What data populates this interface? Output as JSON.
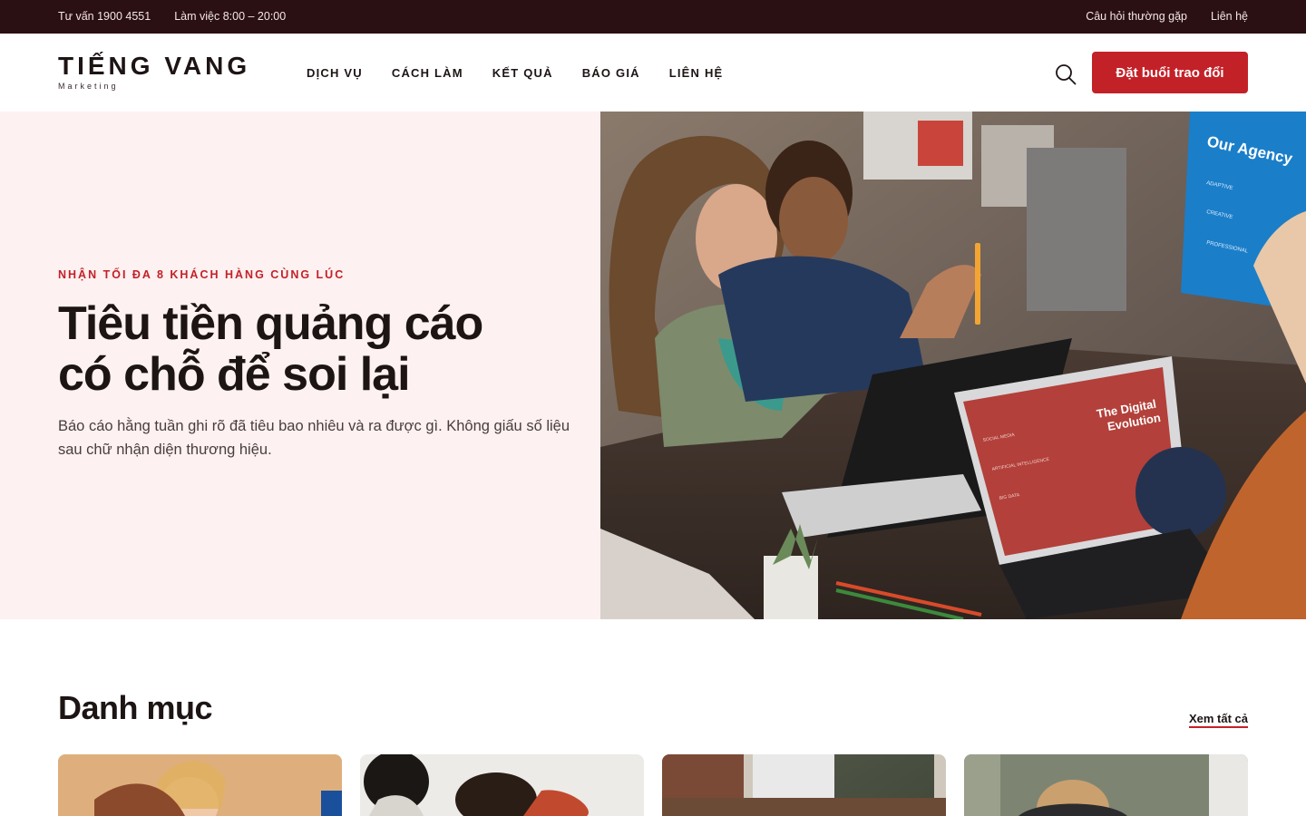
{
  "topbar": {
    "phone": "Tư vấn 1900 4551",
    "hours": "Làm việc 8:00 – 20:00",
    "faq": "Câu hỏi thường gặp",
    "contact": "Liên hệ"
  },
  "header": {
    "logo_title": "TIẾNG VANG",
    "logo_sub": "Marketing",
    "nav": [
      "DỊCH VỤ",
      "CÁCH LÀM",
      "KẾT QUẢ",
      "BÁO GIÁ",
      "LIÊN HỆ"
    ],
    "search_icon": "search-icon",
    "cta_label": "Đặt buổi trao đổi"
  },
  "hero": {
    "eyebrow": "NHẬN TỐI ĐA 8 KHÁCH HÀNG CÙNG LÚC",
    "title_line1": "Tiêu tiền quảng cáo",
    "title_line2": "có chỗ để soi lại",
    "description": "Báo cáo hằng tuần ghi rõ đã tiêu bao nhiêu và ra được gì. Không giấu số liệu sau chữ nhận diện thương hiệu.",
    "image_screen_text": {
      "monitor": "Our Agency",
      "monitor_items": [
        "ADAPTIVE",
        "CREATIVE",
        "PROFESSIONAL"
      ],
      "laptop_title_1": "The Digital",
      "laptop_title_2": "Evolution",
      "laptop_items": [
        "SOCIAL MEDIA",
        "ARTIFICIAL INTELLIGENCE",
        "BIG DATA"
      ]
    }
  },
  "categories": {
    "title": "Danh mục",
    "see_all": "Xem tất cả"
  },
  "colors": {
    "topbar_bg": "#2b1013",
    "accent": "#c32128",
    "hero_bg": "#fdf1f1",
    "text_dark": "#1d1414"
  }
}
